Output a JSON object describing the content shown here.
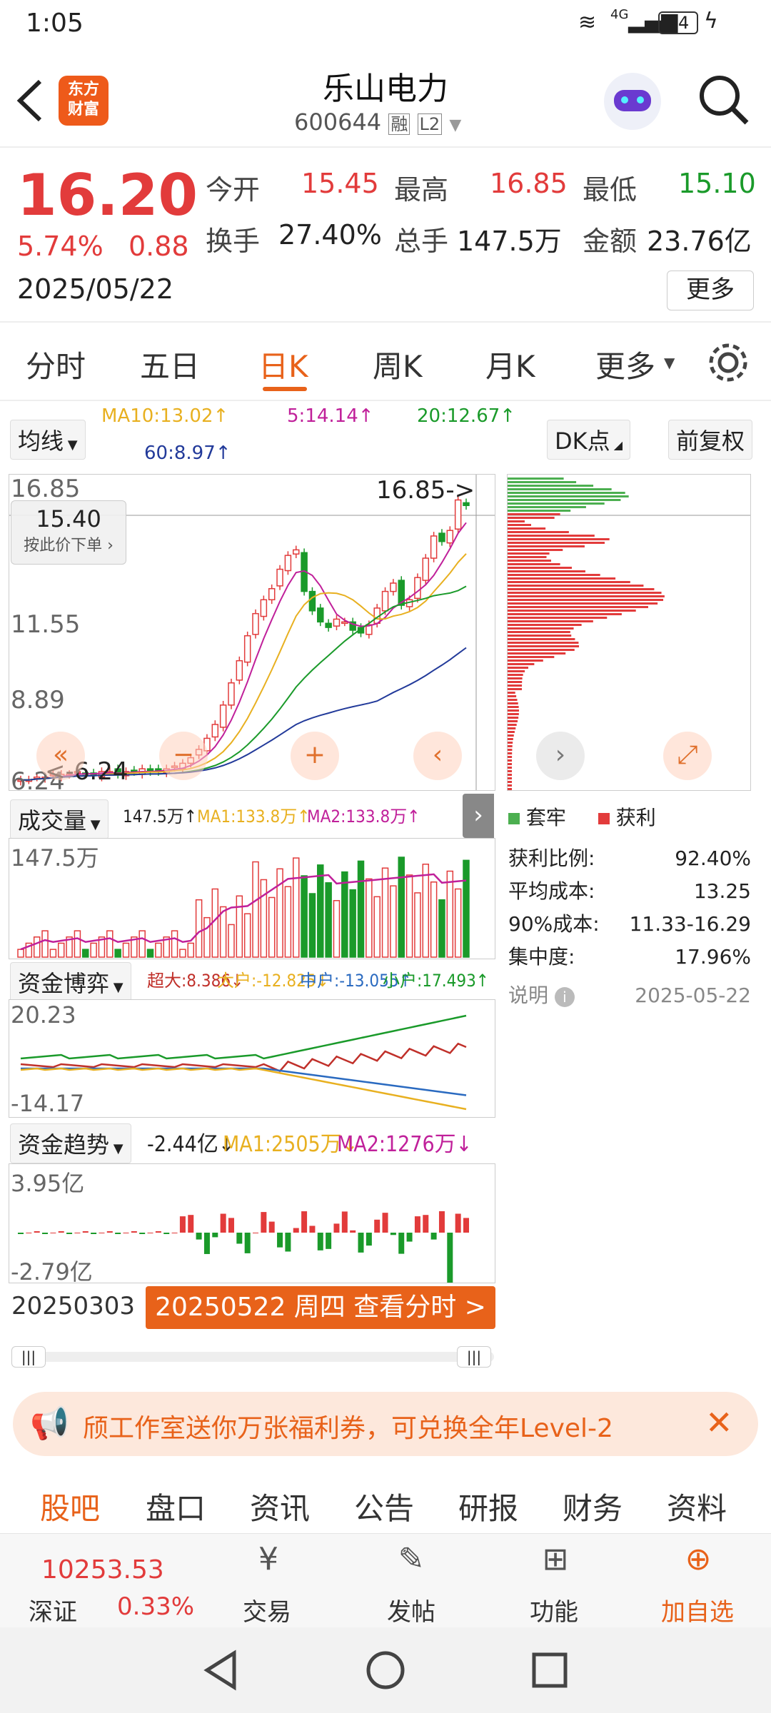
{
  "status": {
    "time": "1:05",
    "network": "4G",
    "battery": "24"
  },
  "header": {
    "logo_line1": "东方",
    "logo_line2": "财富",
    "title": "乐山电力",
    "code": "600644",
    "badge_rong": "融",
    "badge_level": "L2"
  },
  "quote": {
    "price": "16.20",
    "change_pct": "5.74%",
    "change_amt": "0.88",
    "date": "2025/05/22",
    "open_label": "今开",
    "open": "15.45",
    "high_label": "最高",
    "high": "16.85",
    "low_label": "最低",
    "low": "15.10",
    "turnover_label": "换手",
    "turnover": "27.40%",
    "volume_label": "总手",
    "volume": "147.5万",
    "amount_label": "金额",
    "amount": "23.76亿",
    "more_button": "更多"
  },
  "tabs": [
    "分时",
    "五日",
    "日K",
    "周K",
    "月K",
    "更多"
  ],
  "indicators": {
    "ma_selector": "均线",
    "ma10": "MA10:13.02↑",
    "ma5": "5:14.14↑",
    "ma20": "20:12.67↑",
    "ma60": "60:8.97↑",
    "dk_button": "DK点",
    "adjust_button": "前复权"
  },
  "kline": {
    "price_high_label": "16.85",
    "price_11": "11.55",
    "price_8": "8.89",
    "price_low_label": "6.24",
    "max_annotation": "16.85->",
    "min_annotation": "<-6.24",
    "order_price": "15.40",
    "order_hint": "按此价下单"
  },
  "chip_dist": {
    "legend_trapped": "套牢",
    "legend_profit": "获利",
    "rows": [
      {
        "label": "获利比例:",
        "value": "92.40%"
      },
      {
        "label": "平均成本:",
        "value": "13.25"
      },
      {
        "label": "90%成本:",
        "value": "11.33-16.29"
      },
      {
        "label": "集中度:",
        "value": "17.96%"
      }
    ],
    "note_label": "说明",
    "note_date": "2025-05-22"
  },
  "volume": {
    "selector": "成交量",
    "value": "147.5万↑",
    "ma1": "MA1:133.8万↑",
    "ma2": "MA2:133.8万↑",
    "axis_max": "147.5万"
  },
  "capital_game": {
    "selector": "资金博弈",
    "super": "超大:8.386↓",
    "large": "大户:-12.825↓",
    "mid": "中户:-13.055↑",
    "small": "小户:17.493↑",
    "axis_max": "20.23",
    "axis_min": "-14.17"
  },
  "capital_trend": {
    "selector": "资金趋势",
    "value": "-2.44亿↓",
    "ma1": "MA1:2505万↓",
    "ma2": "MA2:1276万↓",
    "axis_max": "3.95亿",
    "axis_min": "-2.79亿"
  },
  "timeline": {
    "start_date": "20250303",
    "selected": "20250522 周四 查看分时 >"
  },
  "banner": {
    "text": "颀工作室送你万张福利券，可兑换全年Level-2"
  },
  "bottom_tabs": [
    "股吧",
    "盘口",
    "资讯",
    "公告",
    "研报",
    "财务",
    "资料"
  ],
  "footer": {
    "index_value": "10253.53",
    "index_name": "深证",
    "index_change": "0.33%",
    "trade": "交易",
    "post": "发帖",
    "functions": "功能",
    "add_watch": "加自选"
  },
  "colors": {
    "accent": "#e8621a",
    "up": "#e23b3b",
    "down": "#1a9a2a",
    "ma10": "#e8b020",
    "ma5": "#c0209a",
    "ma20": "#1a9a2a",
    "ma60": "#223a9a"
  },
  "chart_data": {
    "type": "candlestick",
    "x_start": "20250303",
    "x_end": "20250522",
    "close_approx": [
      6.3,
      6.3,
      6.4,
      6.4,
      6.5,
      6.5,
      6.5,
      6.6,
      6.5,
      6.5,
      6.6,
      6.6,
      6.5,
      6.6,
      6.6,
      6.7,
      6.6,
      6.6,
      6.7,
      6.8,
      6.9,
      7.1,
      7.4,
      7.8,
      8.3,
      9.0,
      9.8,
      10.6,
      11.5,
      12.3,
      12.8,
      13.2,
      13.9,
      14.4,
      14.6,
      13.1,
      12.4,
      12.0,
      11.8,
      12.1,
      12.0,
      11.7,
      11.6,
      11.9,
      12.5,
      13.1,
      13.4,
      12.6,
      12.8,
      13.6,
      14.3,
      15.1,
      14.9,
      15.3,
      16.4,
      16.2
    ],
    "ylim": [
      6.24,
      16.85
    ]
  }
}
